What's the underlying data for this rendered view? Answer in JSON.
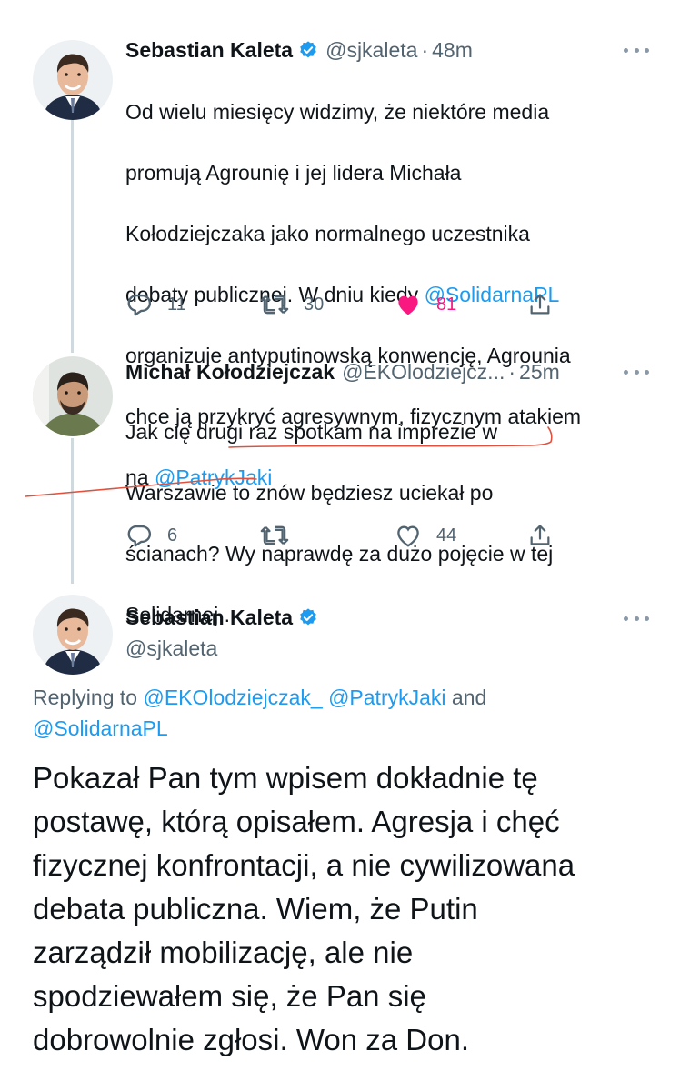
{
  "tweets": [
    {
      "name": "Sebastian Kaleta",
      "verified": true,
      "handle": "@sjkaleta",
      "time": "48m",
      "lines": [
        "Od wielu miesięcy widzimy, że niektóre media",
        "promują Agrounię i jej lidera Michała",
        "Kołodziejczaka jako normalnego uczestnika",
        "debaty publicznej. W dniu kiedy ",
        "organizuje antyputinowską konwencję, Agrounia",
        "chce ją przykryć agresywnym, fizycznym atakiem",
        "na "
      ],
      "mention_1": "@SolidarnaPL",
      "mention_2": "@PatrykJaki",
      "replies": "11",
      "retweets": "30",
      "likes": "81",
      "liked": true
    },
    {
      "name": "Michał Kołodziejczak",
      "verified": false,
      "handle": "@EKOlodziejcz...",
      "time": "25m",
      "lines": [
        "Jak cię drugi raz spotkam na imprezie w",
        "Warszawie to znów będziesz uciekał po",
        "ścianach? Wy naprawdę za dużo pojęcie w tej",
        "Solidarnej.."
      ],
      "replies": "6",
      "retweets": "",
      "likes": "44",
      "liked": false
    }
  ],
  "reply": {
    "name": "Sebastian Kaleta",
    "verified": true,
    "handle": "@sjkaleta",
    "replying_prefix": "Replying to ",
    "replying_to_1": "@EKOlodziejczak_",
    "replying_to_2": "@PatrykJaki",
    "replying_and": " and",
    "replying_to_3": "@SolidarnaPL",
    "lines": [
      "Pokazał Pan tym wpisem dokładnie tę",
      "postawę, którą opisałem. Agresja i chęć",
      "fizycznej konfrontacji, a nie cywilizowana",
      "debata publiczna. Wiem, że Putin",
      "zarządził mobilizację, ale nie",
      "spodziewałem się, że Pan się",
      "dobrowolnie zgłosi. Won za Don."
    ]
  },
  "colors": {
    "link": "#1d9bf0",
    "like_active": "#f91880",
    "secondary_text": "#536471",
    "annotation_red": "#e0523f"
  },
  "icons": [
    "reply-icon",
    "retweet-icon",
    "like-icon",
    "share-icon",
    "more-icon",
    "verified-badge-icon"
  ]
}
